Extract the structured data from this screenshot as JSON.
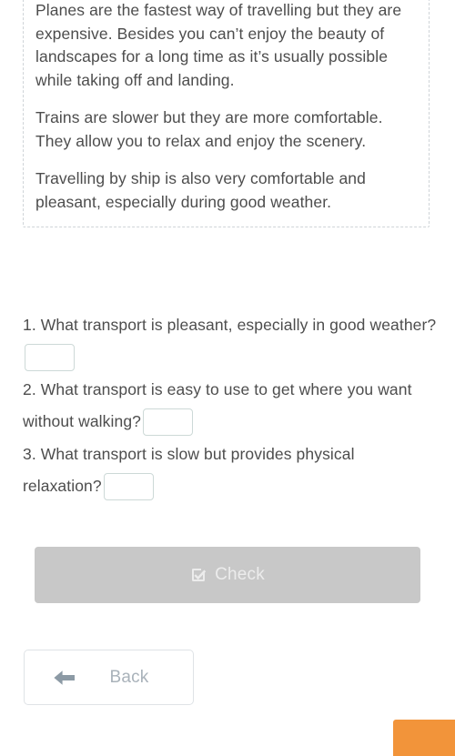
{
  "passage": {
    "paragraphs": [
      "Planes are the fastest way of travelling but they are expensive. Besides you can’t enjoy the beauty of landscapes for a long time as it’s usually possible while taking off and landing.",
      "Trains are slower but they are more comfortable. They allow you to relax and enjoy the scenery.",
      "Travelling by ship is also very comfortable and pleasant, especially during good weather."
    ]
  },
  "questions": [
    {
      "text_before": "1. What transport is pleasant, especially in good weather?",
      "answer_value": "",
      "answer_placeholder": ""
    },
    {
      "text_before": "2. What transport is easy to use to get where you want without walking?",
      "answer_value": "",
      "answer_placeholder": ""
    },
    {
      "text_before": "3. What transport is slow but provides physical relaxation?",
      "answer_value": "",
      "answer_placeholder": ""
    }
  ],
  "actions": {
    "check_label": "Check",
    "check_icon": "checkbox-checked-icon",
    "check_disabled_color": "#c8c8c8",
    "back_label": "Back",
    "back_icon": "arrow-left-icon",
    "back_icon_color": "#8c9aa5"
  },
  "accent": {
    "corner_color": "#f2943a"
  }
}
